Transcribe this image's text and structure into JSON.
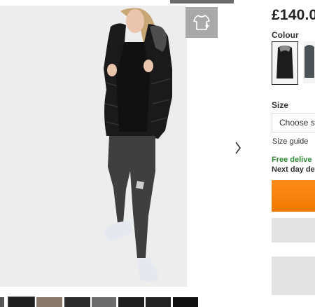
{
  "product": {
    "price": "£140.0",
    "colour_label": "Colour",
    "size_label": "Size",
    "size_placeholder": "Choose s",
    "size_guide": "Size guide",
    "free_delivery": "Free delive",
    "next_day": "Next day de"
  },
  "colours": [
    {
      "name": "black",
      "color": "#1c1c1c",
      "selected": true
    },
    {
      "name": "grey",
      "color": "#4c5357",
      "selected": false
    }
  ],
  "icons": {
    "try_on": "tshirt-plus-icon",
    "next": "chevron-right-icon"
  },
  "buttons": {
    "add_to_bag_color": "#f58220",
    "secondary_color": "#e3e3e3"
  }
}
